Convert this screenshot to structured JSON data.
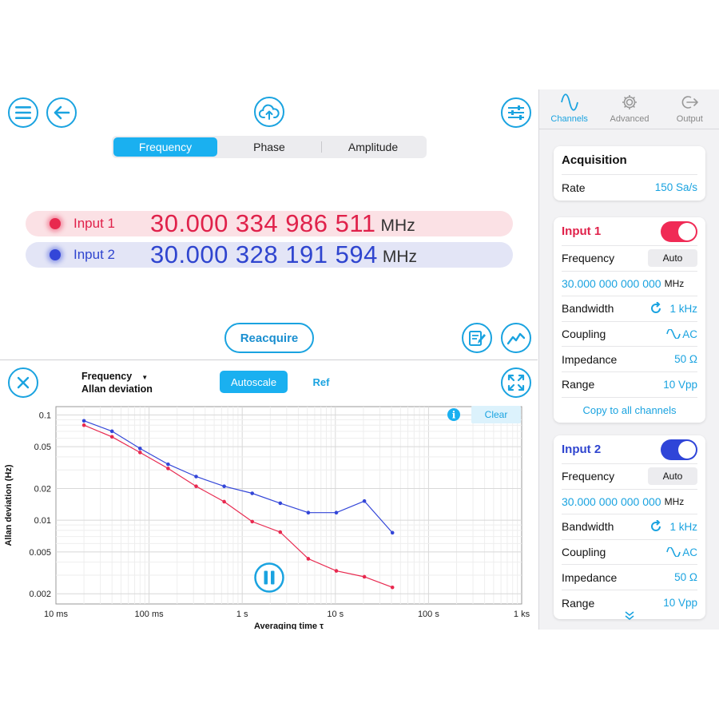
{
  "header": {
    "tabs": [
      {
        "label": "Frequency",
        "active": true
      },
      {
        "label": "Phase",
        "active": false
      },
      {
        "label": "Amplitude",
        "active": false
      }
    ]
  },
  "readouts": [
    {
      "label": "Input 1",
      "value": "30.000 334 986 511",
      "unit": "MHz",
      "color": "#e0214a"
    },
    {
      "label": "Input 2",
      "value": "30.000 328 191 594",
      "unit": "MHz",
      "color": "#2f45cf"
    }
  ],
  "reacquire_label": "Reacquire",
  "plot_toolbar": {
    "selector_line1": "Frequency",
    "selector_line2": "Allan deviation",
    "autoscale_label": "Autoscale",
    "ref_label": "Ref",
    "clear_label": "Clear"
  },
  "chart_data": {
    "type": "line",
    "xlabel": "Averaging time τ",
    "ylabel": "Allan deviation (Hz)",
    "xscale": "log",
    "yscale": "log",
    "xlim": [
      0.01,
      1000
    ],
    "ylim": [
      0.0016,
      0.12
    ],
    "xticks": [
      {
        "v": 0.01,
        "label": "10 ms"
      },
      {
        "v": 0.1,
        "label": "100 ms"
      },
      {
        "v": 1,
        "label": "1 s"
      },
      {
        "v": 10,
        "label": "10 s"
      },
      {
        "v": 100,
        "label": "100 s"
      },
      {
        "v": 1000,
        "label": "1 ks"
      }
    ],
    "yticks": [
      {
        "v": 0.1,
        "label": "0.1"
      },
      {
        "v": 0.05,
        "label": "0.05"
      },
      {
        "v": 0.02,
        "label": "0.02"
      },
      {
        "v": 0.01,
        "label": "0.01"
      },
      {
        "v": 0.005,
        "label": "0.005"
      },
      {
        "v": 0.002,
        "label": "0.002"
      }
    ],
    "grid": true,
    "series": [
      {
        "color": "#3346d8",
        "x": [
          0.02,
          0.04,
          0.08,
          0.16,
          0.32,
          0.64,
          1.28,
          2.56,
          5.12,
          10.24,
          20.48,
          40.96
        ],
        "y": [
          0.088,
          0.07,
          0.048,
          0.034,
          0.026,
          0.021,
          0.018,
          0.0145,
          0.0118,
          0.0118,
          0.0152,
          0.0076
        ]
      },
      {
        "color": "#e8294f",
        "x": [
          0.02,
          0.04,
          0.08,
          0.16,
          0.32,
          0.64,
          1.28,
          2.56,
          5.12,
          10.24,
          20.48,
          40.96
        ],
        "y": [
          0.08,
          0.062,
          0.044,
          0.031,
          0.021,
          0.015,
          0.0097,
          0.0077,
          0.0043,
          0.0033,
          0.0029,
          0.0023
        ]
      }
    ]
  },
  "sidebar": {
    "tabs": [
      {
        "label": "Channels",
        "icon": "sine-wave-icon",
        "active": true
      },
      {
        "label": "Advanced",
        "icon": "gear-icon",
        "active": false
      },
      {
        "label": "Output",
        "icon": "output-icon",
        "active": false
      }
    ],
    "acquisition": {
      "title": "Acquisition",
      "rate_label": "Rate",
      "rate_value": "150 Sa/s"
    },
    "input1": {
      "title": "Input 1",
      "enabled": true,
      "frequency_label": "Frequency",
      "frequency_mode": "Auto",
      "frequency_value": "30.000 000 000 000",
      "frequency_unit": "MHz",
      "bandwidth_label": "Bandwidth",
      "bandwidth_value": "1 kHz",
      "coupling_label": "Coupling",
      "coupling_value": "AC",
      "impedance_label": "Impedance",
      "impedance_value": "50 Ω",
      "range_label": "Range",
      "range_value": "10 Vpp",
      "copy_label": "Copy to all channels"
    },
    "input2": {
      "title": "Input 2",
      "enabled": true,
      "frequency_label": "Frequency",
      "frequency_mode": "Auto",
      "frequency_value": "30.000 000 000 000",
      "frequency_unit": "MHz",
      "bandwidth_label": "Bandwidth",
      "bandwidth_value": "1 kHz",
      "coupling_label": "Coupling",
      "coupling_value": "AC",
      "impedance_label": "Impedance",
      "impedance_value": "50 Ω",
      "range_label": "Range",
      "range_value": "10 Vpp"
    }
  }
}
